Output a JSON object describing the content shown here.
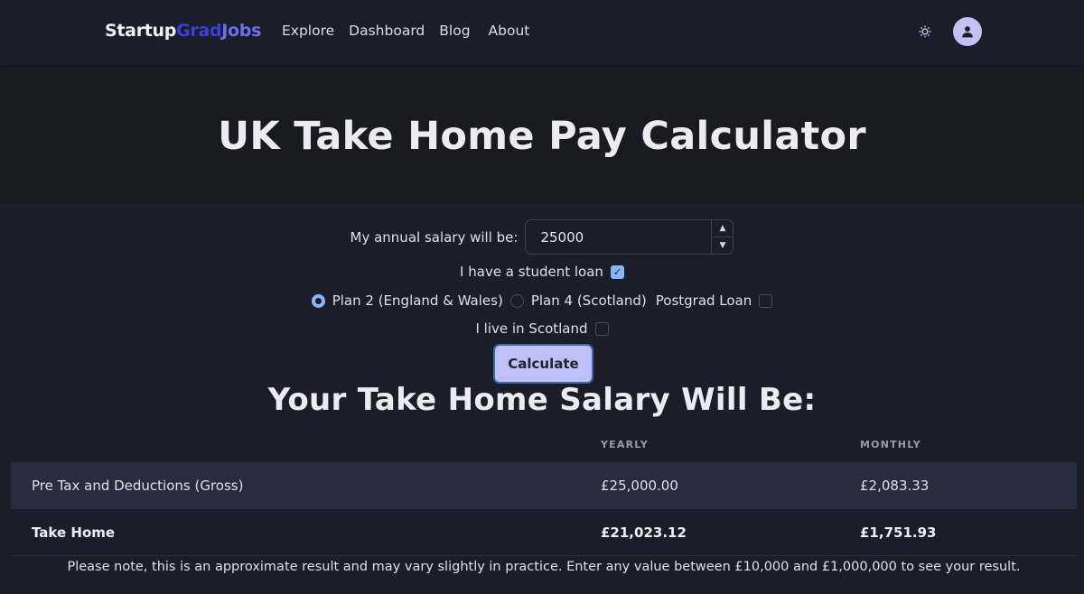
{
  "navbar": {
    "brand": {
      "part1": "Startup",
      "part2": "Grad",
      "part3": "Jobs"
    },
    "links": [
      {
        "label": "Explore"
      },
      {
        "label": "Dashboard"
      },
      {
        "label": "Blog"
      },
      {
        "label": "About"
      }
    ],
    "theme_toggle_icon": "sun-icon",
    "avatar_icon": "user-icon"
  },
  "hero": {
    "title": "UK Take Home Pay Calculator"
  },
  "form": {
    "salary_label": "My annual salary will be:",
    "salary_value": "25000",
    "student_loan_label": "I have a student loan",
    "student_loan_checked": true,
    "plans": [
      {
        "label": "Plan 2 (England & Wales)",
        "selected": true
      },
      {
        "label": "Plan 4 (Scotland)",
        "selected": false
      }
    ],
    "postgrad_label": "Postgrad Loan",
    "postgrad_checked": false,
    "scotland_label": "I live in Scotland",
    "scotland_checked": false,
    "calculate_label": "Calculate"
  },
  "results": {
    "title": "Your Take Home Salary Will Be:",
    "columns": [
      "",
      "YEARLY",
      "MONTHLY"
    ],
    "rows": [
      {
        "label": "Pre Tax and Deductions (Gross)",
        "yearly": "£25,000.00",
        "monthly": "£2,083.33"
      },
      {
        "label": "Take Home",
        "yearly": "£21,023.12",
        "monthly": "£1,751.93"
      }
    ],
    "note": "Please note, this is an approximate result and may vary slightly in practice. Enter any value between £10,000 and £1,000,000 to see your result."
  },
  "colors": {
    "background": "#1b1e28",
    "hero_background": "#1a1a22",
    "accent": "#8ab4f8",
    "button": "#c0c0f8",
    "brand_grad": "#3a3fe0",
    "brand_jobs": "#6b6ff0"
  }
}
